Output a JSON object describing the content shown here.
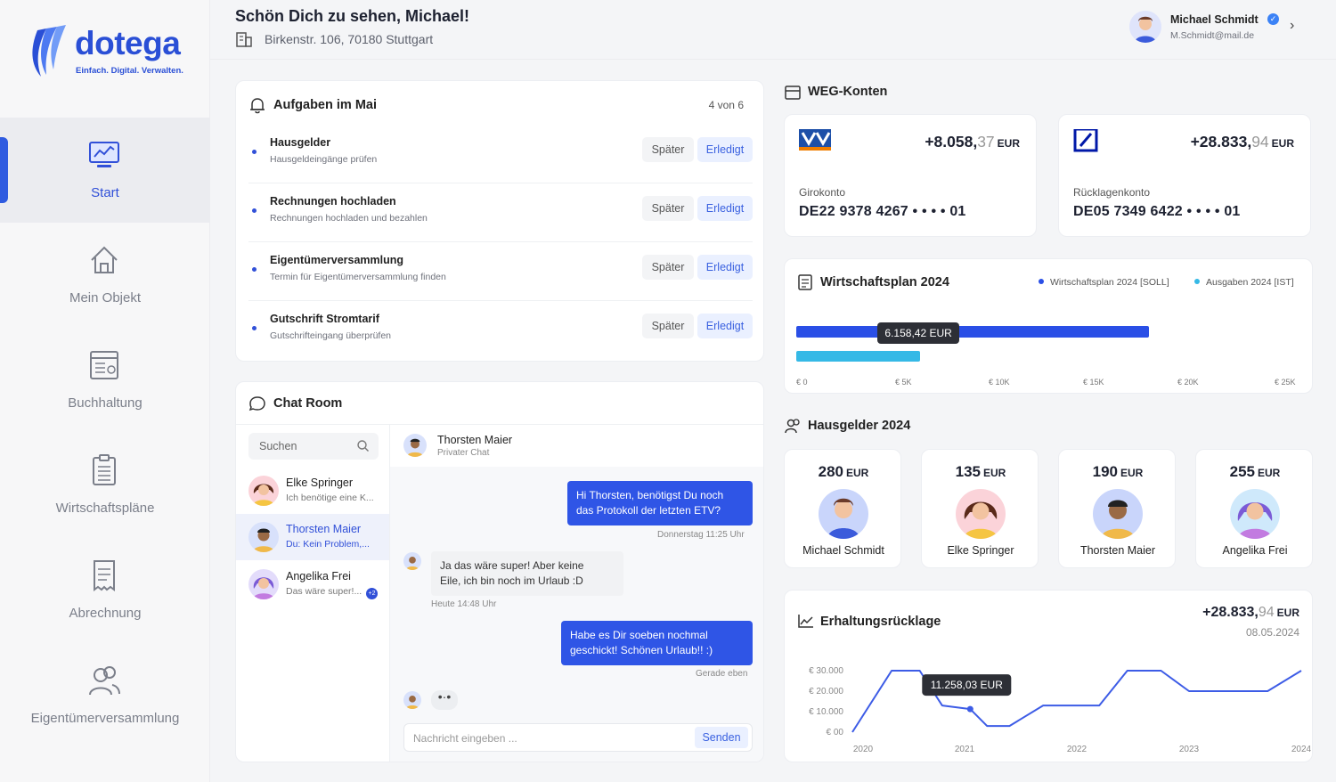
{
  "brand": {
    "name": "dotega",
    "tagline": "Einfach. Digital. Verwalten.",
    "accent": "#2a4fd6"
  },
  "nav": [
    {
      "label": "Start",
      "icon": "monitor-chart-icon",
      "active": true
    },
    {
      "label": "Mein Objekt",
      "icon": "house-icon",
      "active": false
    },
    {
      "label": "Buchhaltung",
      "icon": "ledger-icon",
      "active": false
    },
    {
      "label": "Wirtschaftspläne",
      "icon": "clipboard-list-icon",
      "active": false
    },
    {
      "label": "Abrechnung",
      "icon": "receipt-icon",
      "active": false
    },
    {
      "label": "Eigentümerversammlung",
      "icon": "group-icon",
      "active": false
    }
  ],
  "header": {
    "greeting": "Schön Dich zu sehen, Michael!",
    "address": "Birkenstr. 106, 70180 Stuttgart",
    "user": {
      "name": "Michael Schmidt",
      "email": "M.Schmidt@mail.de"
    }
  },
  "tasks": {
    "title": "Aufgaben im Mai",
    "count": "4 von 6",
    "later_label": "Später",
    "done_label": "Erledigt",
    "items": [
      {
        "title": "Hausgelder",
        "subtitle": "Hausgeldeingänge prüfen"
      },
      {
        "title": "Rechnungen hochladen",
        "subtitle": "Rechnungen hochladen und bezahlen"
      },
      {
        "title": "Eigentümerversammlung",
        "subtitle": "Termin für Eigentümerversammlung finden"
      },
      {
        "title": "Gutschrift Stromtarif",
        "subtitle": "Gutschrifteingang überprüfen"
      }
    ]
  },
  "chat": {
    "title": "Chat Room",
    "search_placeholder": "Suchen",
    "contacts": [
      {
        "name": "Elke Springer",
        "preview": "Ich benötige eine K...",
        "selected": false
      },
      {
        "name": "Thorsten Maier",
        "preview": "Du: Kein Problem,...",
        "selected": true
      },
      {
        "name": "Angelika Frei",
        "preview": "Das wäre super!...",
        "selected": false,
        "badge": "+2"
      }
    ],
    "conversation": {
      "name": "Thorsten Maier",
      "subtitle": "Privater Chat",
      "messages": [
        {
          "dir": "out",
          "lines": [
            "Hi Thorsten, benötigst Du noch",
            "das Protokoll der letzten ETV?"
          ],
          "time": "Donnerstag 11:25 Uhr"
        },
        {
          "dir": "in",
          "lines": [
            "Ja das wäre super! Aber keine",
            "Eile, ich bin noch im Urlaub :D"
          ],
          "time": "Heute 14:48 Uhr"
        },
        {
          "dir": "out",
          "lines": [
            "Habe es Dir soeben nochmal",
            "geschickt! Schönen Urlaub!! :)"
          ],
          "time": "Gerade eben"
        }
      ],
      "typing": "•·•",
      "input_placeholder": "Nachricht eingeben ...",
      "send_label": "Senden"
    }
  },
  "weg": {
    "title": "WEG-Konten",
    "accounts": [
      {
        "bank_icon": "volksbank-logo-icon",
        "balance_main": "+8.058,",
        "balance_cents": "37",
        "currency": "EUR",
        "type": "Girokonto",
        "iban": "DE22 9378 4267 • • • •  01"
      },
      {
        "bank_icon": "deutsche-bank-logo-icon",
        "balance_main": "+28.833,",
        "balance_cents": "94",
        "currency": "EUR",
        "type": "Rücklagenkonto",
        "iban": "DE05 7349 6422 • • • •  01"
      }
    ]
  },
  "plan": {
    "title": "Wirtschaftsplan 2024",
    "legend": [
      {
        "label": "Wirtschaftsplan 2024 [SOLL]",
        "color": "#2a4fe6"
      },
      {
        "label": "Ausgaben 2024 [IST]",
        "color": "#35b9e6"
      }
    ],
    "soll": 17500,
    "ist": 6158.42,
    "tooltip": "6.158,42 EUR",
    "max": 25000,
    "ticks": [
      "€ 0",
      "€ 5K",
      "€ 10K",
      "€ 15K",
      "€ 20K",
      "€ 25K"
    ]
  },
  "hausgelder": {
    "title": "Hausgelder 2024",
    "items": [
      {
        "amount": "280",
        "currency": "EUR",
        "name": "Michael Schmidt"
      },
      {
        "amount": "135",
        "currency": "EUR",
        "name": "Elke Springer"
      },
      {
        "amount": "190",
        "currency": "EUR",
        "name": "Thorsten Maier"
      },
      {
        "amount": "255",
        "currency": "EUR",
        "name": "Angelika Frei"
      }
    ]
  },
  "reserve": {
    "title": "Erhaltungsrücklage",
    "balance_main": "+28.833,",
    "balance_cents": "94",
    "currency": "EUR",
    "date": "08.05.2024",
    "tooltip": "11.258,03 EUR",
    "chart_data": {
      "type": "line",
      "x": [
        2020,
        2020.35,
        2020.6,
        2020.8,
        2021.05,
        2021.2,
        2021.4,
        2021.7,
        2021.9,
        2022.2,
        2022.45,
        2022.75,
        2023.0,
        2023.4,
        2023.7,
        2024.0
      ],
      "y": [
        0,
        30000,
        30000,
        13000,
        11258,
        3000,
        3000,
        13000,
        13000,
        13000,
        30000,
        30000,
        20000,
        20000,
        20000,
        30000
      ],
      "xticks": [
        "2020",
        "2021",
        "2022",
        "2023",
        "2024"
      ],
      "yticks": [
        "€ 30.000",
        "€ 20.000",
        "€ 10.000",
        "€ 00"
      ],
      "ylim": [
        0,
        30000
      ],
      "color": "#3d5ce6"
    }
  }
}
